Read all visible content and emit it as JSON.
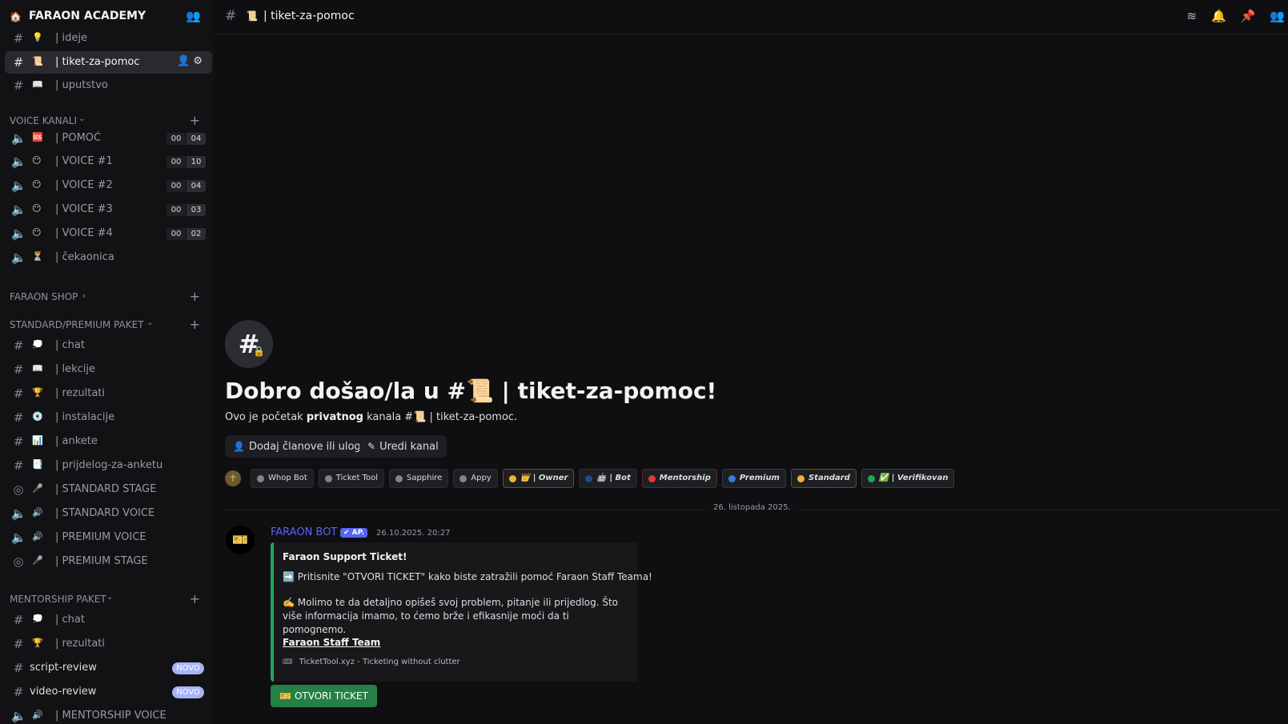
{
  "server": {
    "name": "FARAON ACADEMY"
  },
  "channels_top": [
    {
      "emoji": "💡",
      "label": "| ideje"
    },
    {
      "emoji": "📜",
      "label": "| tiket-za-pomoc"
    },
    {
      "emoji": "📖",
      "label": "| uputstvo"
    }
  ],
  "voice_category": "VOICE KANALI",
  "voice_channels": [
    {
      "emoji": "🆘",
      "label": "|  POMOĆ",
      "count_a": "00",
      "count_b": "04"
    },
    {
      "emoji": "😶",
      "label": "| VOICE #1",
      "count_a": "00",
      "count_b": "10"
    },
    {
      "emoji": "😶",
      "label": "| VOICE #2",
      "count_a": "00",
      "count_b": "04"
    },
    {
      "emoji": "😶",
      "label": "| VOICE #3",
      "count_a": "00",
      "count_b": "03"
    },
    {
      "emoji": "😶",
      "label": "| VOICE #4",
      "count_a": "00",
      "count_b": "02"
    },
    {
      "emoji": "⏳",
      "label": "| čekaonica"
    }
  ],
  "shop_category": "FARAON SHOP",
  "standard_category": "STANDARD/PREMIUM PAKET",
  "standard_channels": [
    {
      "emoji": "💭",
      "label": "| chat"
    },
    {
      "emoji": "📖",
      "label": "| lekcije"
    },
    {
      "emoji": "🏆",
      "label": "| rezultati"
    },
    {
      "emoji": "💿",
      "label": "| instalacije"
    },
    {
      "emoji": "📊",
      "label": "| ankete"
    },
    {
      "emoji": "📑",
      "label": "| prijdelog-za-anketu"
    },
    {
      "emoji": "🎤",
      "label": "| STANDARD STAGE"
    },
    {
      "emoji": "🔊",
      "label": "| STANDARD VOICE"
    },
    {
      "emoji": "🔊",
      "label": "| PREMIUM VOICE"
    },
    {
      "emoji": "🎤",
      "label": "| PREMIUM STAGE"
    }
  ],
  "mentorship_category": "MENTORSHIP PAKET",
  "mentorship_channels": [
    {
      "emoji": "💭",
      "label": "| chat"
    },
    {
      "emoji": "🏆",
      "label": "| rezultati"
    },
    {
      "label": "script-review",
      "badge": "NOVO"
    },
    {
      "label": "video-review",
      "badge": "NOVO"
    },
    {
      "emoji": "🔊",
      "label": "| MENTORSHIP VOICE"
    }
  ],
  "topbar": {
    "emoji": "📜",
    "title": "| tiket-za-pomoc"
  },
  "welcome": {
    "title_prefix": "Dobro došao/la u #",
    "title_emoji": "📜",
    "title_suffix": " | tiket-za-pomoc!",
    "sub_prefix": "Ovo je početak ",
    "sub_bold": "privatnog",
    "sub_mid": " kanala #",
    "sub_emoji": "📜",
    "sub_suffix": " | tiket-za-pomoc.",
    "add_members_label": "Dodaj članove ili uloge",
    "edit_channel_label": "Uredi kanal"
  },
  "roles": [
    {
      "label": "Whop Bot",
      "color": "#80848e",
      "italic": false
    },
    {
      "label": "Ticket Tool",
      "color": "#80848e",
      "italic": false
    },
    {
      "label": "Sapphire",
      "color": "#80848e",
      "italic": false
    },
    {
      "label": "Appy",
      "color": "#80848e",
      "italic": false
    },
    {
      "label": "👑 | Owner",
      "color": "#f0b232",
      "italic": true
    },
    {
      "label": "🤖 | Bot",
      "color": "#1a4b8c",
      "italic": true
    },
    {
      "label": "Mentorship",
      "color": "#e03a3a",
      "italic": true
    },
    {
      "label": "Premium",
      "color": "#3a7be0",
      "italic": true
    },
    {
      "label": "Standard",
      "color": "#f0b232",
      "italic": true
    },
    {
      "label": "✅ | Verifikovan",
      "color": "#23a55a",
      "italic": true
    }
  ],
  "date_divider": "26. listopada 2025.",
  "message": {
    "author": "FARAON BOT",
    "app_tag": "✔ AP.",
    "timestamp": "26.10.2025. 20:27",
    "embed_title": "Faraon Support Ticket!",
    "embed_line1": "➡️ Pritisnite \"OTVORI TICKET\" kako biste zatražili pomoć Faraon Staff Teama!",
    "embed_line2": "✍️ Molimo te da detaljno opišeš svoj problem, pitanje ili prijedlog. Što više informacija imamo, to ćemo brže i efikasnije moći da ti pomognemo.",
    "embed_signature": "Faraon Staff Team",
    "embed_footer": "TicketTool.xyz - Ticketing without clutter",
    "button_label": "OTVORI TICKET"
  },
  "colors": {
    "accent": "#5865f2",
    "success": "#248046",
    "novo_badge": "#a7b4f7"
  }
}
